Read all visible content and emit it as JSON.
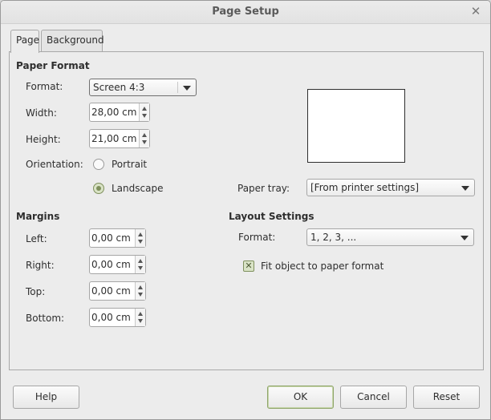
{
  "window": {
    "title": "Page Setup"
  },
  "tabs": [
    {
      "label": "Page",
      "active": true
    },
    {
      "label": "Background",
      "active": false
    }
  ],
  "paper_format": {
    "heading": "Paper Format",
    "format_label": "Format:",
    "format_value": "Screen 4:3",
    "width_label": "Width:",
    "width_value": "28,00 cm",
    "height_label": "Height:",
    "height_value": "21,00 cm",
    "orientation_label": "Orientation:",
    "portrait_label": "Portrait",
    "landscape_label": "Landscape",
    "orientation_selected": "Landscape",
    "paper_tray_label": "Paper tray:",
    "paper_tray_value": "[From printer settings]"
  },
  "margins": {
    "heading": "Margins",
    "left_label": "Left:",
    "left_value": "0,00 cm",
    "right_label": "Right:",
    "right_value": "0,00 cm",
    "top_label": "Top:",
    "top_value": "0,00 cm",
    "bottom_label": "Bottom:",
    "bottom_value": "0,00 cm"
  },
  "layout_settings": {
    "heading": "Layout Settings",
    "format_label": "Format:",
    "format_value": "1, 2, 3, ...",
    "fit_label": "Fit object to paper format",
    "fit_checked": true
  },
  "buttons": {
    "help": "Help",
    "ok": "OK",
    "cancel": "Cancel",
    "reset": "Reset"
  },
  "colors": {
    "accent": "#7e8f5c",
    "window_bg": "#ececec"
  },
  "icons": {
    "close": "close-icon",
    "dropdown": "chevron-down-icon",
    "spin_up": "arrow-up-icon",
    "spin_down": "arrow-down-icon",
    "check": "checkmark-icon"
  }
}
